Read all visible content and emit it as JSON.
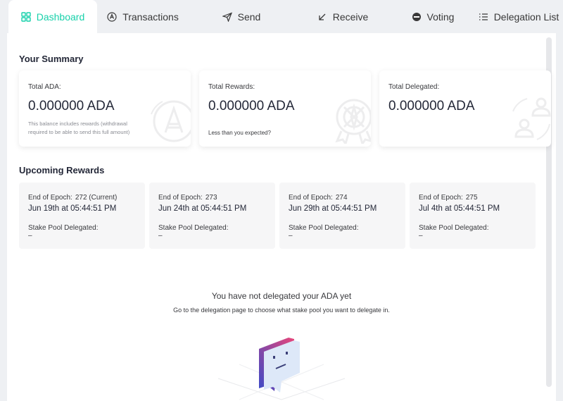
{
  "tabs": [
    {
      "label": "Dashboard",
      "icon": "dashboard-icon",
      "active": true
    },
    {
      "label": "Transactions",
      "icon": "transactions-icon",
      "active": false
    },
    {
      "label": "Send",
      "icon": "send-icon",
      "active": false
    },
    {
      "label": "Receive",
      "icon": "receive-icon",
      "active": false
    },
    {
      "label": "Voting",
      "icon": "voting-icon",
      "active": false
    },
    {
      "label": "Delegation List",
      "icon": "list-icon",
      "active": false
    }
  ],
  "summary": {
    "title": "Your Summary",
    "total_ada": {
      "label": "Total ADA:",
      "amount": "0.000000 ADA",
      "note": "This balance includes rewards (withdrawal required to be able to send this full amount)"
    },
    "total_rewards": {
      "label": "Total Rewards:",
      "amount": "0.000000 ADA",
      "link": "Less than you expected?"
    },
    "total_delegated": {
      "label": "Total Delegated:",
      "amount": "0.000000 ADA"
    }
  },
  "upcoming": {
    "title": "Upcoming Rewards",
    "epoch_label": "End of Epoch:",
    "pool_label": "Stake Pool Delegated:",
    "pool_value": "–",
    "epochs": [
      {
        "number": "272 (Current)",
        "date": "Jun 19th at 05:44:51 PM"
      },
      {
        "number": "273",
        "date": "Jun 24th at 05:44:51 PM"
      },
      {
        "number": "274",
        "date": "Jun 29th at 05:44:51 PM"
      },
      {
        "number": "275",
        "date": "Jul 4th at 05:44:51 PM"
      }
    ]
  },
  "empty_state": {
    "title": "You have not delegated your ADA yet",
    "subtitle": "Go to the delegation page to choose what stake pool you want to delegate in."
  },
  "colors": {
    "accent": "#17d1aa",
    "text": "#242838",
    "background": "#eef0f3"
  }
}
